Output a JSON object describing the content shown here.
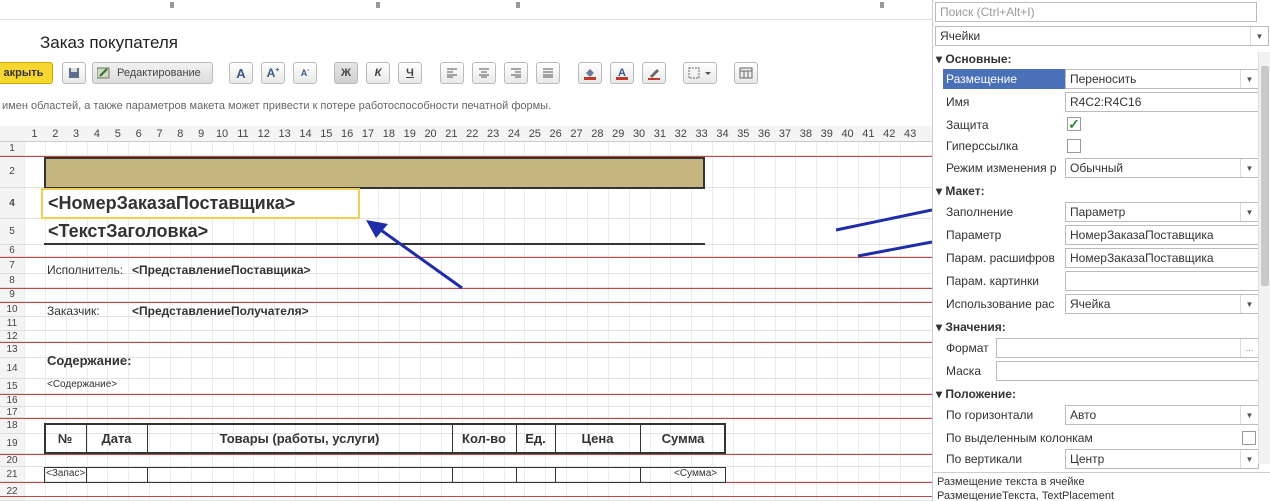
{
  "window": {
    "title": "Заказ покупателя"
  },
  "toolbar": {
    "close_label": "акрыть",
    "edit_label": "Редактирование",
    "bold": "Ж",
    "italic": "К",
    "underline": "Ч"
  },
  "warning": "имен областей, а также параметров макета может привести к потере работоспособности печатной формы.",
  "sheet": {
    "columns": [
      "1",
      "2",
      "3",
      "4",
      "5",
      "6",
      "7",
      "8",
      "9",
      "10",
      "11",
      "12",
      "13",
      "14",
      "15",
      "16",
      "17",
      "18",
      "19",
      "20",
      "21",
      "22",
      "23",
      "24",
      "25",
      "26",
      "27",
      "28",
      "29",
      "30",
      "31",
      "32",
      "33",
      "34",
      "35",
      "36",
      "37",
      "38",
      "39",
      "40",
      "41",
      "42",
      "43"
    ],
    "rows": [
      "1",
      "2",
      "4",
      "5",
      "6",
      "7",
      "8",
      "9",
      "10",
      "11",
      "12",
      "13",
      "14",
      "15",
      "16",
      "17",
      "18",
      "19",
      "20",
      "21",
      "22"
    ],
    "order_number_param": "<НомерЗаказаПоставщика>",
    "header_text_param": "<ТекстЗаголовка>",
    "executor_label": "Исполнитель:",
    "executor_value": "<ПредставлениеПоставщика>",
    "customer_label": "Заказчик:",
    "customer_value": "<ПредставлениеПолучателя>",
    "content_label": "Содержание:",
    "content_value": "<Содержание>",
    "table_headers": [
      "№",
      "Дата",
      "Товары (работы, услуги)",
      "Кол-во",
      "Ед.",
      "Цена",
      "Сумма"
    ],
    "row_zapas": "<Запас>",
    "row_summa": "<Сумма>"
  },
  "panel": {
    "search_placeholder": "Поиск (Ctrl+Alt+I)",
    "mode": "Ячейки",
    "sections": {
      "basic": "Основные:",
      "layout": "Макет:",
      "values": "Значения:",
      "position": "Положение:"
    },
    "props": {
      "placement_label": "Размещение",
      "placement_value": "Переносить",
      "name_label": "Имя",
      "name_value": "R4C2:R4C16",
      "protect_label": "Защита",
      "hyperlink_label": "Гиперссылка",
      "edit_mode_label": "Режим изменения р",
      "edit_mode_value": "Обычный",
      "fill_label": "Заполнение",
      "fill_value": "Параметр",
      "param_label": "Параметр",
      "param_value": "НомерЗаказаПоставщика",
      "decode_label": "Парам. расшифров",
      "decode_value": "НомерЗаказаПоставщика",
      "picture_label": "Парам. картинки",
      "usage_label": "Использование рас",
      "usage_value": "Ячейка",
      "format_label": "Формат",
      "mask_label": "Маска",
      "hpos_label": "По горизонтали",
      "hpos_value": "Авто",
      "selcols_label": "По выделенным колонкам",
      "vpos_label": "По вертикали",
      "vpos_value": "Центр"
    },
    "description_title": "Размещение текста в ячейке",
    "description_sub": "РазмещениеТекста, TextPlacement"
  },
  "colors": {
    "accent_yellow": "#f7d630",
    "band": "#c6b580",
    "red_line": "#c24848",
    "arrow": "#1f2ea8",
    "select": "#4a70b8"
  }
}
